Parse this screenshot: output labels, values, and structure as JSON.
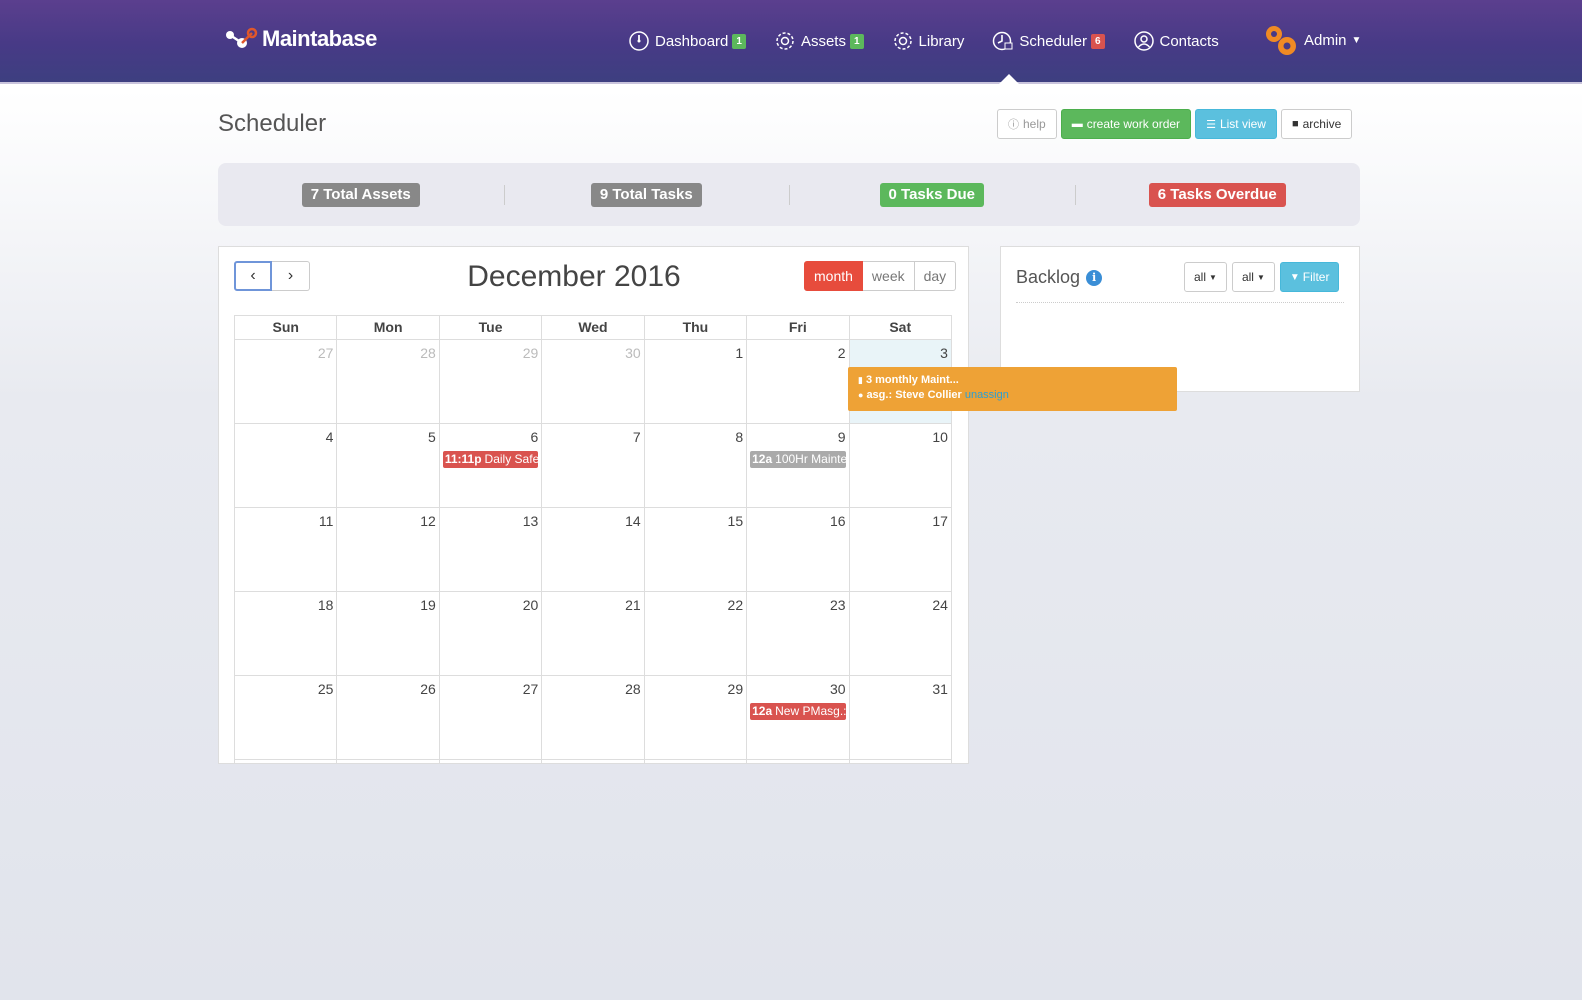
{
  "brand": {
    "name": "Maintabase"
  },
  "nav": {
    "items": [
      {
        "label": "Dashboard",
        "badge": "1",
        "badge_color": "#5cb85c",
        "icon": "dashboard-icon"
      },
      {
        "label": "Assets",
        "badge": "1",
        "badge_color": "#5cb85c",
        "icon": "gear-icon"
      },
      {
        "label": "Library",
        "badge": null,
        "icon": "gear-icon"
      },
      {
        "label": "Scheduler",
        "badge": "6",
        "badge_color": "#d9534f",
        "icon": "clock-icon"
      },
      {
        "label": "Contacts",
        "badge": null,
        "icon": "user-circle-icon"
      }
    ],
    "admin_label": "Admin"
  },
  "page": {
    "title": "Scheduler"
  },
  "toolbar": {
    "help_label": "help",
    "create_label": "create work order",
    "list_label": "List view",
    "archive_label": "archive"
  },
  "stats": {
    "total_assets": "7 Total Assets",
    "total_tasks": "9 Total Tasks",
    "tasks_due": "0 Tasks Due",
    "tasks_overdue": "6 Tasks Overdue"
  },
  "calendar": {
    "title": "December 2016",
    "views": {
      "month": "month",
      "week": "week",
      "day": "day"
    },
    "weekdays": [
      "Sun",
      "Mon",
      "Tue",
      "Wed",
      "Thu",
      "Fri",
      "Sat"
    ],
    "weeks": [
      [
        "27",
        "28",
        "29",
        "30",
        "1",
        "2",
        "3"
      ],
      [
        "4",
        "5",
        "6",
        "7",
        "8",
        "9",
        "10"
      ],
      [
        "11",
        "12",
        "13",
        "14",
        "15",
        "16",
        "17"
      ],
      [
        "18",
        "19",
        "20",
        "21",
        "22",
        "23",
        "24"
      ],
      [
        "25",
        "26",
        "27",
        "28",
        "29",
        "30",
        "31"
      ]
    ],
    "events": {
      "tue6": {
        "time": "11:11p",
        "title": "Daily Safe"
      },
      "fri9": {
        "time": "12a",
        "title": "100Hr Mainte"
      },
      "fri30": {
        "time": "12a",
        "title": "New PMasg.:"
      }
    }
  },
  "popover": {
    "title": "3 monthly Maint...",
    "assignee_prefix": "asg.:",
    "assignee": "Steve Collier",
    "unassign": "unassign"
  },
  "backlog": {
    "title": "Backlog",
    "filter_a": "all",
    "filter_b": "all",
    "filter_btn": "Filter"
  },
  "colors": {
    "accent_red": "#e74c3c",
    "success": "#5cb85c",
    "info": "#5bc0de",
    "warning": "#eea236"
  }
}
